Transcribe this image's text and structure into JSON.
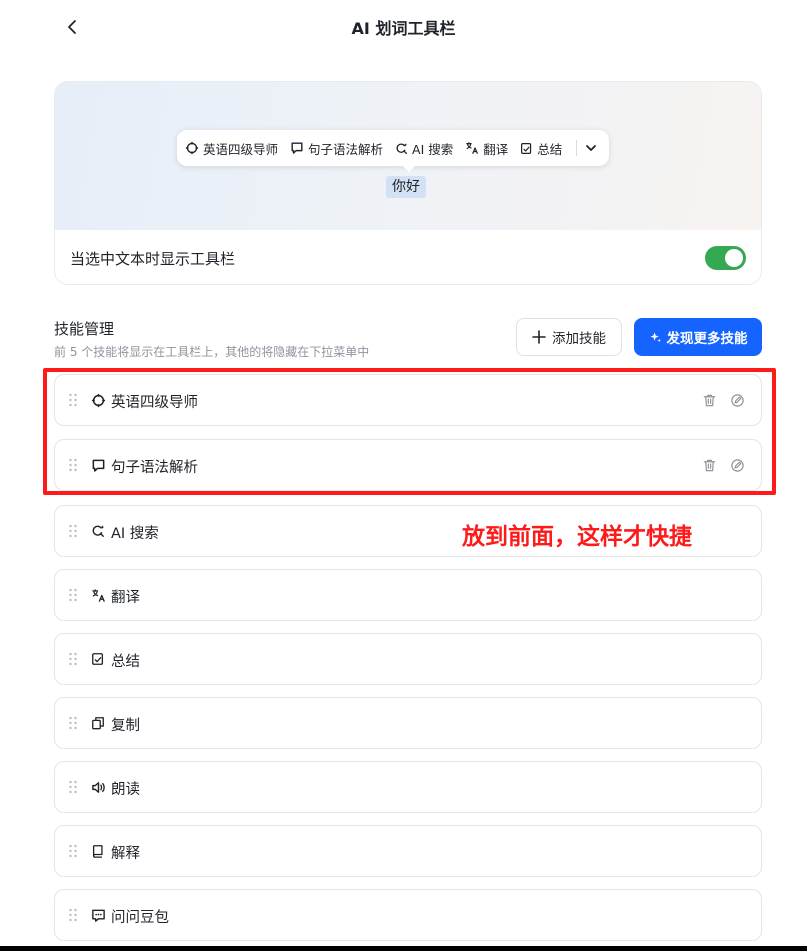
{
  "header": {
    "title": "AI 划词工具栏"
  },
  "preview": {
    "toolbar_items": [
      {
        "label": "英语四级导师",
        "icon": "target-icon"
      },
      {
        "label": "句子语法解析",
        "icon": "chat-bubble-icon"
      },
      {
        "label": "AI 搜索",
        "icon": "ai-search-icon"
      },
      {
        "label": "翻译",
        "icon": "translate-icon"
      },
      {
        "label": "总结",
        "icon": "summary-icon"
      }
    ],
    "selected_text": "你好",
    "toggle_label": "当选中文本时显示工具栏",
    "toggle_on": true
  },
  "skills_section": {
    "title": "技能管理",
    "description": "前 5 个技能将显示在工具栏上，其他的将隐藏在下拉菜单中",
    "add_button": "添加技能",
    "discover_button": "发现更多技能"
  },
  "skills": [
    {
      "label": "英语四级导师",
      "icon": "target-icon",
      "custom": true
    },
    {
      "label": "句子语法解析",
      "icon": "chat-bubble-icon",
      "custom": true
    },
    {
      "label": "AI 搜索",
      "icon": "ai-search-icon",
      "custom": false
    },
    {
      "label": "翻译",
      "icon": "translate-icon",
      "custom": false
    },
    {
      "label": "总结",
      "icon": "summary-icon",
      "custom": false
    },
    {
      "label": "复制",
      "icon": "copy-icon",
      "custom": false
    },
    {
      "label": "朗读",
      "icon": "speaker-icon",
      "custom": false
    },
    {
      "label": "解释",
      "icon": "book-icon",
      "custom": false
    },
    {
      "label": "问问豆包",
      "icon": "message-icon",
      "custom": false
    }
  ],
  "annotation": {
    "text": "放到前面，这样才快捷",
    "color": "#ff1a1a"
  },
  "colors": {
    "accent": "#1664ff",
    "toggle": "#34a853"
  }
}
